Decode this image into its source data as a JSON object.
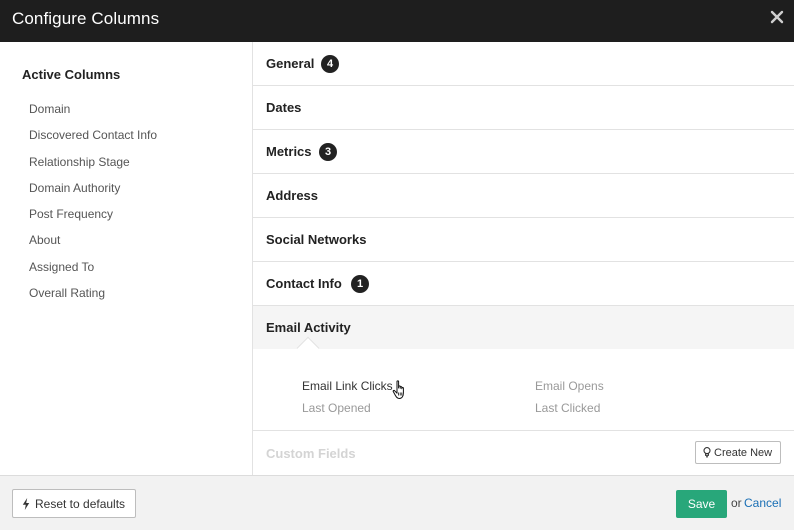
{
  "dialog": {
    "title": "Configure Columns"
  },
  "sidebar": {
    "heading": "Active Columns",
    "items": [
      "Domain",
      "Discovered Contact Info",
      "Relationship Stage",
      "Domain Authority",
      "Post Frequency",
      "About",
      "Assigned To",
      "Overall Rating"
    ]
  },
  "sections": [
    {
      "label": "General",
      "badge": "4"
    },
    {
      "label": "Dates",
      "badge": ""
    },
    {
      "label": "Metrics",
      "badge": "3"
    },
    {
      "label": "Address",
      "badge": ""
    },
    {
      "label": "Social Networks",
      "badge": ""
    },
    {
      "label": "Contact Info",
      "badge": "1"
    },
    {
      "label": "Email Activity",
      "badge": ""
    }
  ],
  "email_activity": {
    "options": [
      {
        "label": "Email Link Clicks",
        "selected": true
      },
      {
        "label": "Email Opens",
        "selected": false
      },
      {
        "label": "Last Opened",
        "selected": false
      },
      {
        "label": "Last Clicked",
        "selected": false
      }
    ]
  },
  "custom_fields": {
    "label": "Custom Fields",
    "create_label": "Create New"
  },
  "footer": {
    "reset_label": "Reset to defaults",
    "save_label": "Save",
    "or_text": "or",
    "cancel_label": "Cancel"
  },
  "colors": {
    "header_bg": "#1e1e1e",
    "save_bg": "#28a77a",
    "cancel_link": "#1a6fb5",
    "badge_bg": "#222222"
  },
  "icons": {
    "close": "close-icon",
    "bulb": "lightbulb-icon",
    "bolt": "lightning-bolt-icon",
    "cursor": "hand-pointer-icon"
  }
}
